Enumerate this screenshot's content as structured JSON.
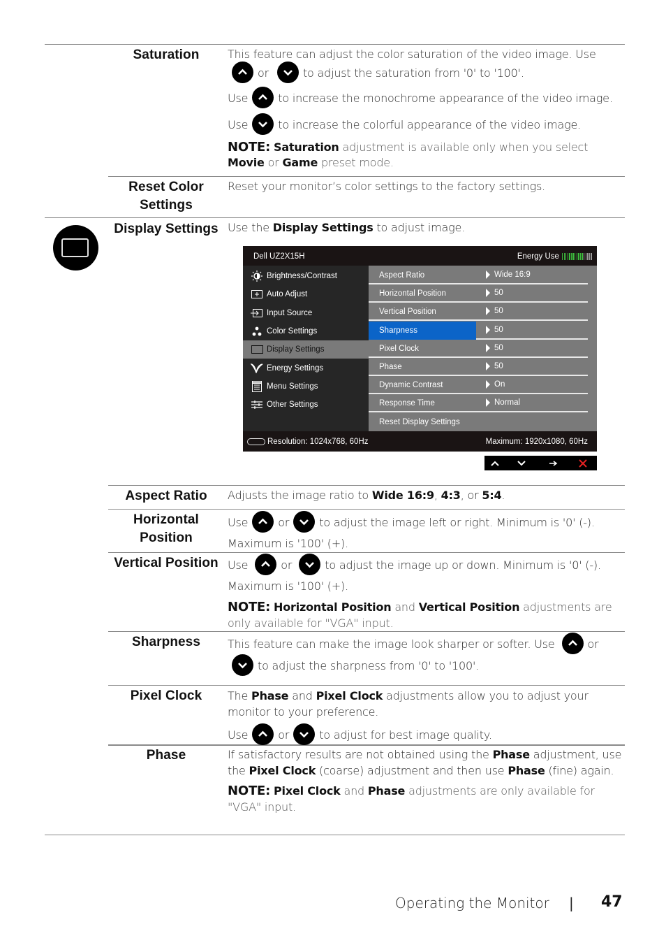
{
  "rows": {
    "saturation": {
      "term": "Saturation",
      "p1a": "This feature can adjust the color saturation of the video image. Use",
      "or": "or",
      "p1b": "to adjust the saturation from '0' to '100'.",
      "p2a": "Use",
      "p2b": "to increase the monochrome appearance of the video image.",
      "p3a": "Use",
      "p3b": "to increase the colorful appearance of the video image.",
      "note_label": "NOTE:",
      "note_b1": "Saturation",
      "note_t1": " adjustment is available only when you select ",
      "note_b2": "Movie",
      "note_t2": " or ",
      "note_b3": "Game",
      "note_t3": " preset mode."
    },
    "reset_color": {
      "term_line1": "Reset Color",
      "term_line2": "Settings",
      "desc": "Reset your monitor’s color settings to the factory settings."
    },
    "display_settings": {
      "term": "Display Settings",
      "desc_a": "Use the ",
      "desc_b": "Display Settings",
      "desc_c": " to adjust image."
    },
    "aspect_ratio": {
      "term": "Aspect Ratio",
      "t1": "Adjusts the image ratio to ",
      "b1": "Wide 16:9",
      "t2": ", ",
      "b2": "4:3",
      "t3": ", or ",
      "b3": "5:4",
      "t4": "."
    },
    "horizontal_position": {
      "term_line1": "Horizontal",
      "term_line2": "Position",
      "a": "Use",
      "or": "or",
      "b": "to adjust the image left or right. Minimum is '0' (-).",
      "c": "Maximum is '100' (+)."
    },
    "vertical_position": {
      "term": "Vertical Position",
      "a": "Use",
      "or": "or",
      "b": "to adjust the image up or down. Minimum is '0' (-).",
      "c": "Maximum is '100' (+).",
      "note_label": "NOTE:",
      "note_b1": "Horizontal Position",
      "note_t1": " and ",
      "note_b2": "Vertical Position",
      "note_t2": " adjustments are only available for \"VGA\" input."
    },
    "sharpness": {
      "term": "Sharpness",
      "a": "This feature can make the image look sharper or softer. Use",
      "or": "or",
      "b": "to adjust the sharpness from '0' to '100'."
    },
    "pixel_clock": {
      "term": "Pixel Clock",
      "t1": "The ",
      "b1": "Phase",
      "t2": " and ",
      "b2": "Pixel Clock",
      "t3": " adjustments allow you to adjust your monitor to your preference.",
      "u1": "Use",
      "or": "or",
      "u2": "to adjust for best image quality."
    },
    "phase": {
      "term": "Phase",
      "t1": "If satisfactory results are not obtained using the ",
      "b1": "Phase",
      "t2": " adjustment, use the ",
      "b2": "Pixel Clock",
      "t3": " (coarse) adjustment and then use ",
      "b3": "Phase",
      "t4": " (fine) again.",
      "note_label": "NOTE:",
      "note_b1": "Pixel Clock",
      "note_t1": " and ",
      "note_b2": "Phase",
      "note_t2": " adjustments are only available for \"VGA\" input."
    }
  },
  "osd": {
    "model": "Dell UZ2X15H",
    "energy_label": "Energy Use",
    "energy_level": 0.7,
    "energy_ticks": 17,
    "colors": {
      "selected": "#0b64c8",
      "energy_on": "#3dbb3d",
      "energy_off": "#9a9a9a",
      "close": "#e52222"
    },
    "menu": [
      {
        "label": "Brightness/Contrast",
        "icon": "brightness-icon"
      },
      {
        "label": "Auto Adjust",
        "icon": "auto-adjust-icon"
      },
      {
        "label": "Input Source",
        "icon": "input-source-icon"
      },
      {
        "label": "Color Settings",
        "icon": "color-settings-icon"
      },
      {
        "label": "Display Settings",
        "icon": "display-settings-icon",
        "active": true
      },
      {
        "label": "Energy Settings",
        "icon": "energy-settings-icon"
      },
      {
        "label": "Menu Settings",
        "icon": "menu-settings-icon"
      },
      {
        "label": "Other Settings",
        "icon": "other-settings-icon"
      }
    ],
    "options": [
      {
        "label": "Aspect Ratio",
        "value": "Wide 16:9"
      },
      {
        "label": "Horizontal Position",
        "value": "50"
      },
      {
        "label": "Vertical Position",
        "value": "50"
      },
      {
        "label": "Sharpness",
        "value": "50",
        "selected": true
      },
      {
        "label": "Pixel Clock",
        "value": "50"
      },
      {
        "label": "Phase",
        "value": "50"
      },
      {
        "label": "Dynamic Contrast",
        "value": "On"
      },
      {
        "label": "Response Time",
        "value": "Normal"
      },
      {
        "label": "Reset Display Settings",
        "value": null
      }
    ],
    "resolution": "Resolution: 1024x768, 60Hz",
    "maximum": "Maximum: 1920x1080, 60Hz",
    "keys": [
      "up",
      "down",
      "enter",
      "exit"
    ]
  },
  "footer": {
    "section": "Operating the Monitor",
    "separator": "|",
    "page": "47"
  }
}
